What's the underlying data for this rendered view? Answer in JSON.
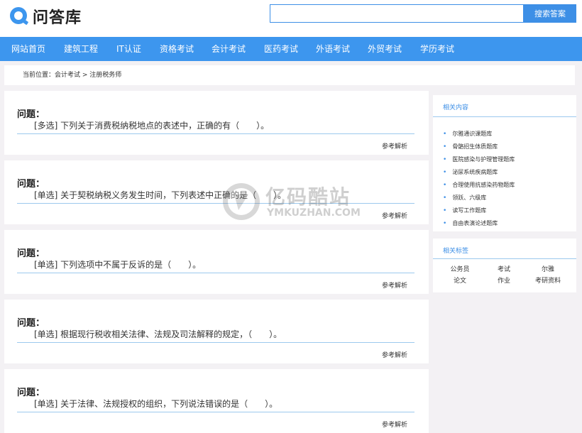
{
  "header": {
    "logo_text": "问答库",
    "search_placeholder": "",
    "search_button": "搜索答案"
  },
  "nav": {
    "items": [
      "网站首页",
      "建筑工程",
      "IT认证",
      "资格考试",
      "会计考试",
      "医药考试",
      "外语考试",
      "外贸考试",
      "学历考试"
    ]
  },
  "breadcrumb": "当前位置：会计考试 > 注册税务师",
  "questions": [
    {
      "title": "问题：",
      "text": "[多选] 下列关于消费税纳税地点的表述中，正确的有（　　）。",
      "link": "参考解析"
    },
    {
      "title": "问题：",
      "text": "[单选] 关于契税纳税义务发生时间，下列表述中正确的是（　　）。",
      "link": "参考解析"
    },
    {
      "title": "问题：",
      "text": "[单选] 下列选项中不属于反诉的是（　　）。",
      "link": "参考解析"
    },
    {
      "title": "问题：",
      "text": "[单选] 根据现行税收相关法律、法规及司法解释的规定，（　　）。",
      "link": "参考解析"
    },
    {
      "title": "问题：",
      "text": "[单选] 关于法律、法规授权的组织，下列说法错误的是（　　）。",
      "link": "参考解析"
    }
  ],
  "sidebar": {
    "related_title": "相关内容",
    "related_items": [
      "尔雅通识课题库",
      "骨骼招生体质题库",
      "医院感染与护理管理题库",
      "泌尿系统疾病题库",
      "合理使用抗感染药物题库",
      "领跃、六级库",
      "读写工作题库",
      "自由表演论述题库"
    ],
    "tags_title": "相关标签",
    "tags": [
      "公务员",
      "考试",
      "尔雅",
      "论文",
      "作业",
      "考研资料"
    ]
  },
  "watermark": {
    "text_cn": "亿码酷站",
    "text_en": "YMKUZHAN.COM"
  },
  "colors": {
    "accent": "#3d96ee",
    "line": "#9cc9ee",
    "background": "#f3f1f4"
  }
}
